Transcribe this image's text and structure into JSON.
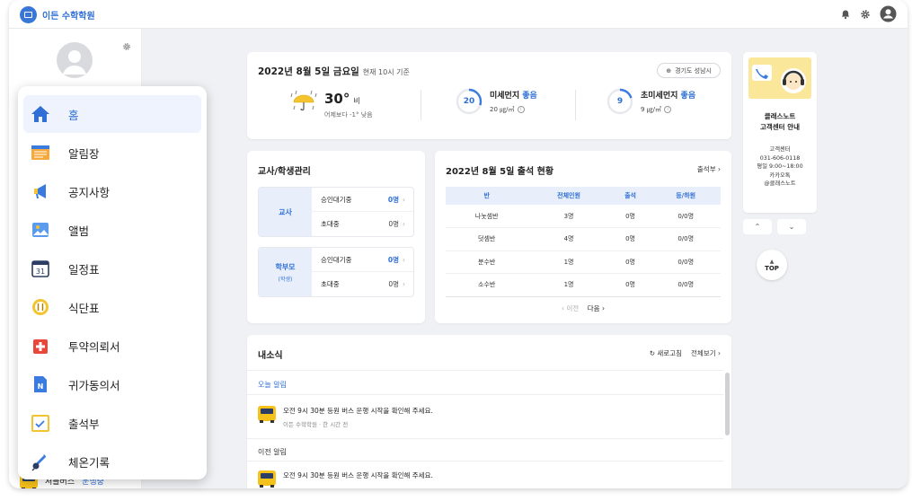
{
  "app": {
    "title": "이든 수학학원"
  },
  "colors": {
    "accent": "#2f6fd6",
    "background": "#f0f1f4",
    "panel": "#ffffff"
  },
  "weather": {
    "date_title": "2022년 8월 5일 금요일",
    "date_sub": "현재 10시 기준",
    "region_button": "경기도 성남시",
    "temp": "30°",
    "condition": "비",
    "compare": "어제보다 -1° 낮음",
    "pm10": {
      "label": "미세먼지",
      "status": "좋음",
      "value": "20",
      "unit": "20 ㎍/㎥",
      "gauge_fraction": 0.3
    },
    "pm25": {
      "label": "초미세먼지",
      "status": "좋음",
      "value": "9",
      "unit": "9 ㎍/㎥",
      "gauge_fraction": 0.2
    }
  },
  "management": {
    "title": "교사/학생관리",
    "groups": [
      {
        "label": "교사",
        "sub": "",
        "rows": [
          {
            "label": "승인대기중",
            "count": "0명"
          },
          {
            "label": "초대중",
            "count": "0명"
          }
        ]
      },
      {
        "label": "학부모",
        "sub": "(학생)",
        "rows": [
          {
            "label": "승인대기중",
            "count": "0명"
          },
          {
            "label": "초대중",
            "count": "0명"
          }
        ]
      }
    ]
  },
  "attendance": {
    "title": "2022년 8월 5일 출석 현황",
    "link": "출석부",
    "headers": [
      "반",
      "전체인원",
      "출석",
      "등/하원"
    ],
    "rows": [
      [
        "나눗셈반",
        "3명",
        "0명",
        "0/0명"
      ],
      [
        "덧셈반",
        "4명",
        "0명",
        "0/0명"
      ],
      [
        "분수반",
        "1명",
        "0명",
        "0/0명"
      ],
      [
        "소수반",
        "1명",
        "0명",
        "0/0명"
      ]
    ],
    "prev": "이전",
    "next": "다음"
  },
  "news": {
    "title": "내소식",
    "refresh": "새로고침",
    "view_all": "전체보기",
    "today_label": "오늘 알림",
    "prev_label": "이전 알림",
    "items": [
      {
        "text": "오전 9시 30분 등원 버스 운행 시작을 확인해 주세요.",
        "source": "이든 수학학원",
        "time": "한 시간 전"
      },
      {
        "text": "오전 9시 30분 등원 버스 운행 시작을 확인해 주세요."
      }
    ]
  },
  "support": {
    "title": "클래스노트\n고객센터 안내",
    "lines": [
      "고객센터",
      "031-606-0118",
      "평일 9:00~18:00",
      "카카오톡",
      "@클래스노트"
    ]
  },
  "nav": {
    "up": "^",
    "down": "v",
    "top_label": "TOP"
  },
  "left_bus": {
    "label": "셔틀버스",
    "status": "운행중"
  },
  "menu": {
    "items": [
      {
        "label": "홈",
        "icon": "home-icon"
      },
      {
        "label": "알림장",
        "icon": "notebook-icon"
      },
      {
        "label": "공지사항",
        "icon": "megaphone-icon"
      },
      {
        "label": "앨범",
        "icon": "album-icon"
      },
      {
        "label": "일정표",
        "icon": "calendar-icon"
      },
      {
        "label": "식단표",
        "icon": "meal-icon"
      },
      {
        "label": "투약의뢰서",
        "icon": "medicine-icon"
      },
      {
        "label": "귀가동의서",
        "icon": "consent-icon"
      },
      {
        "label": "출석부",
        "icon": "attendance-icon"
      },
      {
        "label": "체온기록",
        "icon": "thermometer-icon"
      }
    ]
  }
}
